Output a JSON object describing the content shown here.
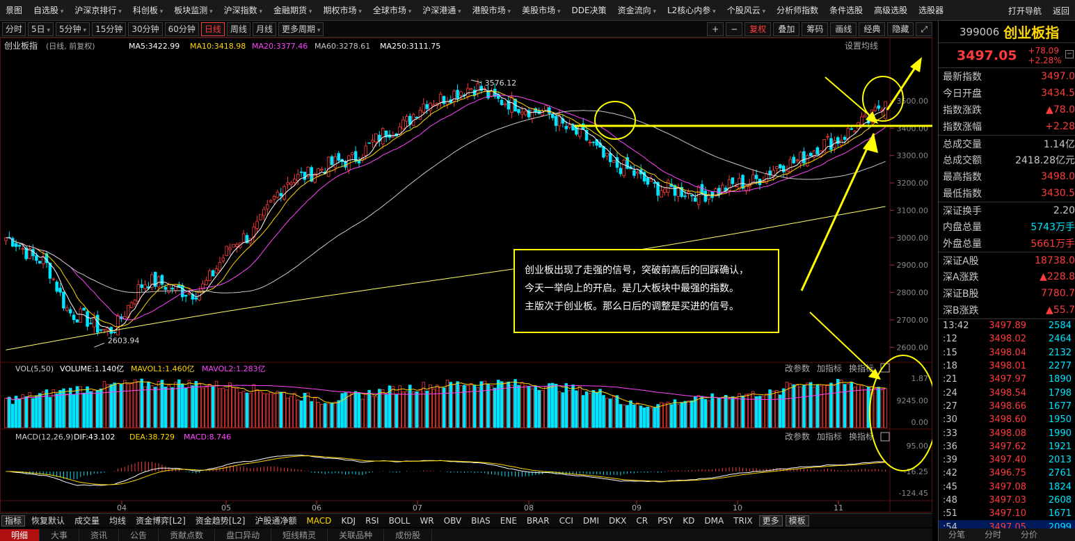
{
  "menu": {
    "items": [
      "景图",
      "自选股",
      "沪深京排行",
      "科创板",
      "板块监测",
      "沪深指数",
      "金融期货",
      "期权市场",
      "全球市场",
      "沪深港通",
      "港股市场",
      "美股市场",
      "DDE决策",
      "资金流向",
      "L2核心内参",
      "个股风云",
      "分析师指数",
      "条件选股",
      "高级选股",
      "选股器"
    ],
    "right_items": [
      "打开导航",
      "返回"
    ]
  },
  "periods": {
    "items": [
      "分时",
      "5日",
      "5分钟",
      "15分钟",
      "30分钟",
      "60分钟",
      "日线",
      "周线",
      "月线",
      "更多周期"
    ],
    "active": "日线"
  },
  "tools": {
    "items": [
      "+",
      "−",
      "复权",
      "叠加",
      "筹码",
      "画线",
      "经典",
      "隐藏",
      "⤢"
    ]
  },
  "colors": {
    "up": "#ff3b3b",
    "down": "#00e5ff",
    "ma5": "#ffffff",
    "ma10": "#ffd700",
    "ma20": "#ff44ff",
    "ma60": "#c8c8c8",
    "ma250": "#ffff66",
    "annotation": "#ffff00",
    "grid": "#5a1010"
  },
  "chart_data": [
    {
      "type": "candlestick",
      "title": "创业板指",
      "subtitle": "(日线, 前复权)",
      "ylim": [
        2550,
        3680
      ],
      "yticks": [
        "3500.00",
        "3400.00",
        "3300.00",
        "3200.00",
        "3100.00",
        "3000.00",
        "2900.00",
        "2800.00",
        "2700.00",
        "2600.00"
      ],
      "xticks": [
        "04",
        "05",
        "06",
        "07",
        "08",
        "09",
        "10",
        "11"
      ],
      "legend": [
        "MA5:3422.99",
        "MA10:3418.98",
        "MA20:3377.46",
        "MA60:3278.61",
        "MA250:3111.75"
      ],
      "settings_label": "设置均线",
      "high_label": "3576.12",
      "low_label": "2603.94",
      "anchors": [
        {
          "i": 0,
          "v": 3000
        },
        {
          "i": 10,
          "v": 2920
        },
        {
          "i": 20,
          "v": 2720
        },
        {
          "i": 30,
          "v": 2660
        },
        {
          "i": 42,
          "v": 2840
        },
        {
          "i": 55,
          "v": 2800
        },
        {
          "i": 70,
          "v": 3000
        },
        {
          "i": 85,
          "v": 3220
        },
        {
          "i": 100,
          "v": 3280
        },
        {
          "i": 115,
          "v": 3400
        },
        {
          "i": 125,
          "v": 3500
        },
        {
          "i": 138,
          "v": 3550
        },
        {
          "i": 145,
          "v": 3500
        },
        {
          "i": 158,
          "v": 3460
        },
        {
          "i": 168,
          "v": 3380
        },
        {
          "i": 180,
          "v": 3260
        },
        {
          "i": 193,
          "v": 3180
        },
        {
          "i": 205,
          "v": 3160
        },
        {
          "i": 218,
          "v": 3200
        },
        {
          "i": 230,
          "v": 3270
        },
        {
          "i": 243,
          "v": 3350
        },
        {
          "i": 253,
          "v": 3420
        },
        {
          "i": 259,
          "v": 3497
        }
      ]
    },
    {
      "type": "bar",
      "title": "VOL",
      "legend": [
        "VOL(5,50)",
        "VOLUME:1.140亿",
        "MAVOL1:1.460亿",
        "MAVOL2:1.283亿"
      ],
      "yticks": [
        "1.87",
        "9245.00",
        "0.00"
      ],
      "actions": [
        "改参数",
        "加指标",
        "换指标"
      ]
    },
    {
      "type": "bar",
      "title": "MACD",
      "legend": [
        "MACD(12,26,9)",
        "DIF:43.102",
        "DEA:38.729",
        "MACD:8.746"
      ],
      "yticks": [
        "95.00",
        "-16.25",
        "-124.45"
      ],
      "actions": [
        "改参数",
        "加指标",
        "换指标"
      ]
    }
  ],
  "annotation": {
    "lines": [
      "创业板出现了走强的信号，突破前高后的回踩确认，",
      "今天一举向上的开启。是几大板块中最强的指数。",
      "主版次于创业板。那么日后的调整是买进的信号。"
    ]
  },
  "indicators": {
    "items": [
      "指标",
      "恢复默认",
      "成交量",
      "均线",
      "资金博弈[L2]",
      "资金趋势[L2]",
      "沪股通净额",
      "MACD",
      "KDJ",
      "RSI",
      "BOLL",
      "WR",
      "OBV",
      "BIAS",
      "ENE",
      "BRAR",
      "CCI",
      "DMI",
      "DKX",
      "CR",
      "PSY",
      "KD",
      "DMA",
      "TRIX",
      "更多",
      "模板"
    ]
  },
  "bottom_tabs": {
    "items": [
      "明细",
      "大事",
      "资讯",
      "公告",
      "贡献点数",
      "盘口异动",
      "短线精灵",
      "关联品种",
      "成份股"
    ]
  },
  "quote": {
    "code": "399006",
    "name": "创业板指",
    "price": "3497.05",
    "change": "+78.09",
    "change_pct": "+2.28%",
    "fields": [
      {
        "k": "最新指数",
        "v": "3497.0",
        "s": "up"
      },
      {
        "k": "今日开盘",
        "v": "3434.5",
        "s": "up"
      },
      {
        "k": "指数涨跌",
        "v": "▲78.0",
        "s": "up"
      },
      {
        "k": "指数涨幅",
        "v": "+2.28",
        "s": "up"
      },
      {
        "k": "总成交量",
        "v": "1.14亿",
        "s": "w"
      },
      {
        "k": "总成交额",
        "v": "2418.28亿元",
        "s": "w"
      },
      {
        "k": "最高指数",
        "v": "3498.0",
        "s": "up"
      },
      {
        "k": "最低指数",
        "v": "3430.5",
        "s": "up"
      },
      {
        "k": "深证换手",
        "v": "2.20",
        "s": "w"
      },
      {
        "k": "内盘总量",
        "v": "5743万手",
        "s": "c"
      },
      {
        "k": "外盘总量",
        "v": "5661万手",
        "s": "up"
      },
      {
        "k": "深证A股",
        "v": "18738.0",
        "s": "up"
      },
      {
        "k": "深A涨跌",
        "v": "▲228.8",
        "s": "up"
      },
      {
        "k": "深证B股",
        "v": "7780.7",
        "s": "up"
      },
      {
        "k": "深B涨跌",
        "v": "▲55.7",
        "s": "up"
      }
    ],
    "ticks": [
      {
        "t": "13:42",
        "p": "3497.89",
        "q": "2584"
      },
      {
        "t": ":12",
        "p": "3498.02",
        "q": "2464"
      },
      {
        "t": ":15",
        "p": "3498.04",
        "q": "2132"
      },
      {
        "t": ":18",
        "p": "3498.01",
        "q": "2277"
      },
      {
        "t": ":21",
        "p": "3497.97",
        "q": "1890"
      },
      {
        "t": ":24",
        "p": "3498.54",
        "q": "1798"
      },
      {
        "t": ":27",
        "p": "3498.66",
        "q": "1677"
      },
      {
        "t": ":30",
        "p": "3498.60",
        "q": "1950"
      },
      {
        "t": ":33",
        "p": "3498.08",
        "q": "1990"
      },
      {
        "t": ":36",
        "p": "3497.62",
        "q": "1921"
      },
      {
        "t": ":39",
        "p": "3497.40",
        "q": "2013"
      },
      {
        "t": ":42",
        "p": "3496.75",
        "q": "2761"
      },
      {
        "t": ":45",
        "p": "3497.08",
        "q": "1824"
      },
      {
        "t": ":48",
        "p": "3497.03",
        "q": "2608"
      },
      {
        "t": ":51",
        "p": "3497.10",
        "q": "1671"
      },
      {
        "t": ":54",
        "p": "3497.05",
        "q": "2099"
      }
    ],
    "foot": [
      "分笔",
      "分时",
      "分价"
    ]
  }
}
